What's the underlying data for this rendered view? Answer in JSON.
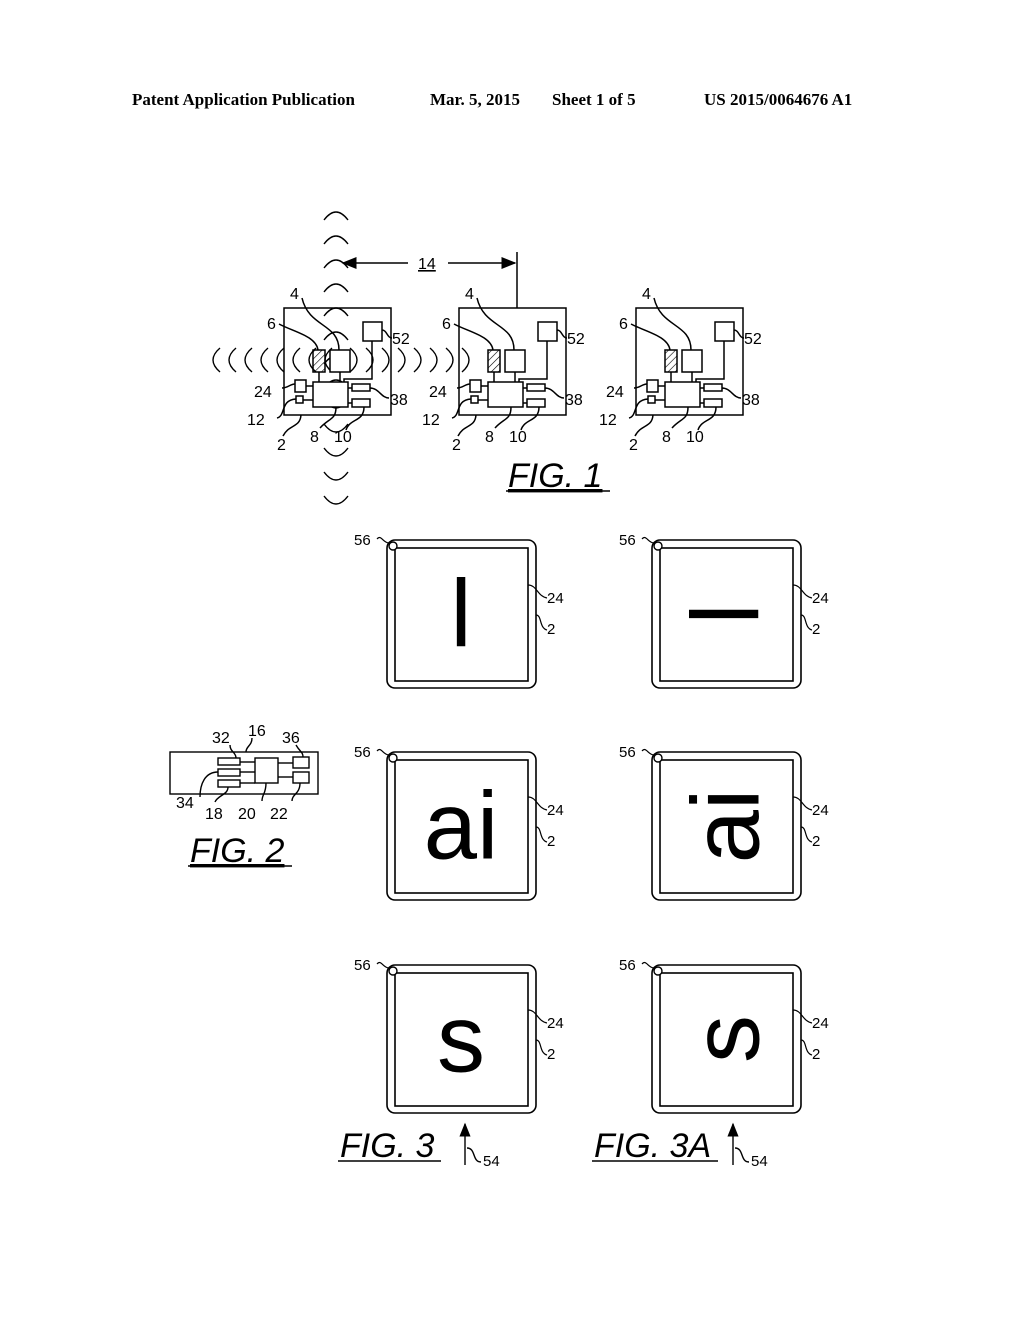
{
  "header": {
    "publication_type": "Patent Application Publication",
    "date": "Mar. 5, 2015",
    "sheet": "Sheet 1 of 5",
    "publication_number": "US 2015/0064676 A1"
  },
  "figures": {
    "fig1": {
      "caption": "FIG. 1",
      "distance_label": "14",
      "device_labels": {
        "antenna": "4",
        "sensor": "6",
        "module": "52",
        "part24": "24",
        "part12": "12",
        "device": "2",
        "processor": "8",
        "part10": "10",
        "part38": "38"
      },
      "device_count": 3
    },
    "fig2": {
      "caption": "FIG. 2",
      "labels": [
        "32",
        "16",
        "36",
        "34",
        "18",
        "20",
        "22"
      ]
    },
    "fig3_panels": [
      {
        "glyph": "l",
        "rotation_deg": 0,
        "labels": {
          "corner": "56",
          "display": "24",
          "device": "2"
        }
      },
      {
        "glyph": "l",
        "rotation_deg": -90,
        "labels": {
          "corner": "56",
          "display": "24",
          "device": "2"
        }
      },
      {
        "glyph": "ai",
        "rotation_deg": 0,
        "labels": {
          "corner": "56",
          "display": "24",
          "device": "2"
        }
      },
      {
        "glyph": "ai",
        "rotation_deg": -90,
        "labels": {
          "corner": "56",
          "display": "24",
          "device": "2"
        }
      },
      {
        "glyph": "s",
        "rotation_deg": 0,
        "labels": {
          "corner": "56",
          "display": "24",
          "device": "2"
        }
      },
      {
        "glyph": "s",
        "rotation_deg": -90,
        "labels": {
          "corner": "56",
          "display": "24",
          "device": "2"
        }
      }
    ],
    "fig3": {
      "caption": "FIG. 3",
      "arrow_label": "54"
    },
    "fig3a": {
      "caption": "FIG. 3A",
      "arrow_label": "54"
    }
  }
}
